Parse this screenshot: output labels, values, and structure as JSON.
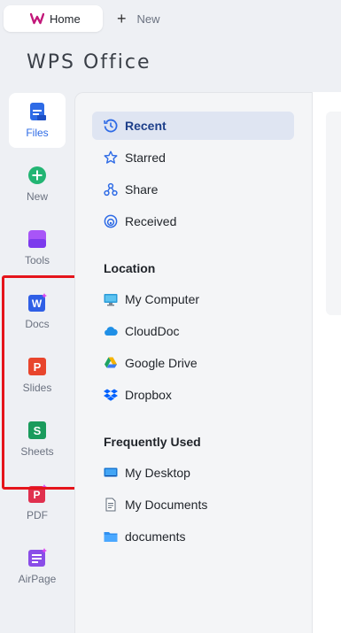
{
  "tabs": {
    "home_label": "Home",
    "new_label": "New"
  },
  "app": {
    "title": "WPS Office"
  },
  "rail": {
    "items": [
      {
        "label": "Files",
        "icon": "files-icon"
      },
      {
        "label": "New",
        "icon": "new-plus-icon"
      },
      {
        "label": "Tools",
        "icon": "tools-icon"
      },
      {
        "label": "Docs",
        "icon": "docs-icon"
      },
      {
        "label": "Slides",
        "icon": "slides-icon"
      },
      {
        "label": "Sheets",
        "icon": "sheets-icon"
      },
      {
        "label": "PDF",
        "icon": "pdf-icon"
      },
      {
        "label": "AirPage",
        "icon": "airpage-icon"
      }
    ]
  },
  "nav": {
    "primary": [
      {
        "label": "Recent",
        "icon": "recent-clock-icon"
      },
      {
        "label": "Starred",
        "icon": "star-icon"
      },
      {
        "label": "Share",
        "icon": "share-icon"
      },
      {
        "label": "Received",
        "icon": "received-icon"
      }
    ],
    "location_title": "Location",
    "location": [
      {
        "label": "My Computer",
        "icon": "computer-icon"
      },
      {
        "label": "CloudDoc",
        "icon": "cloud-icon"
      },
      {
        "label": "Google Drive",
        "icon": "google-drive-icon"
      },
      {
        "label": "Dropbox",
        "icon": "dropbox-icon"
      }
    ],
    "frequent_title": "Frequently Used",
    "frequent": [
      {
        "label": "My Desktop",
        "icon": "desktop-icon"
      },
      {
        "label": "My Documents",
        "icon": "documents-icon"
      },
      {
        "label": "documents",
        "icon": "folder-icon"
      }
    ]
  },
  "colors": {
    "accent": "#2e6be6",
    "highlight": "#e5141b",
    "docs": "#2f5fe6",
    "slides": "#e8452c",
    "sheets": "#1a9b5c",
    "pdf": "#e0304e",
    "airpage": "#8a4de8"
  }
}
